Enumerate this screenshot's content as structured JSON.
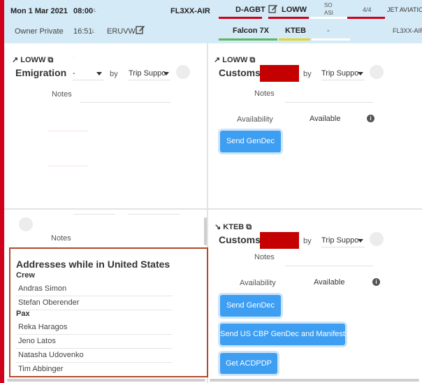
{
  "header": {
    "date": "Mon 1 Mar 2021",
    "time": "08:00",
    "time_suffix": "L",
    "flight": "FL3XX-AIR",
    "aircraft_reg": "D-AGBT",
    "airport_from": "LOWW",
    "so_top": "SO",
    "so_bottom": "ASI",
    "count": "4/4",
    "operator": "JET AVIATION",
    "trip_type": "Owner Private",
    "time2": "16:51",
    "time2_suffix": "L",
    "crew_code": "ERUVW",
    "aircraft_type": "Falcon 7X",
    "airport_to": "KTEB",
    "dash": "-",
    "flight2": "FL3XX-AIR"
  },
  "panels": {
    "emigration": {
      "airport": "LOWW",
      "title": "Emigration",
      "select_value": "-",
      "by": "by",
      "support": "Trip Suppo",
      "notes": "Notes"
    },
    "customs_dep": {
      "airport": "LOWW",
      "title": "Customs",
      "by": "by",
      "support": "Trip Suppo",
      "notes": "Notes",
      "availability_label": "Availability",
      "availability_value": "Available",
      "gendec_btn": "Send GenDec"
    },
    "lower_left": {
      "notes": "Notes"
    },
    "customs_arr": {
      "airport": "KTEB",
      "title": "Customs",
      "by": "by",
      "support": "Trip Suppo",
      "notes": "Notes",
      "availability_label": "Availability",
      "availability_value": "Available",
      "gendec_btn": "Send GenDec",
      "cbp_btn": "Send US CBP GenDec and Manifest",
      "acpdp_btn": "Get ACDPDP"
    }
  },
  "addresses": {
    "title": "Addresses while in United States",
    "crew_label": "Crew",
    "crew": [
      "Andras Simon",
      "Stefan Oberender"
    ],
    "pax_label": "Pax",
    "pax": [
      "Reka Haragos",
      "Jeno Latos",
      "Natasha Udovenko",
      "Tim Abbinger"
    ]
  },
  "colors": {
    "accent_red": "#d0021b",
    "header_bg": "#d4eaf6",
    "button_blue": "#3d9ef2",
    "green_underline": "#5cb85c",
    "yellow_underline": "#e6d51a"
  },
  "icons": {
    "edit": "edit-icon",
    "external": "external-link-icon",
    "departure": "departure-arrow-icon",
    "arrival": "arrival-arrow-icon",
    "info": "info-icon",
    "dropdown": "chevron-down-icon"
  }
}
